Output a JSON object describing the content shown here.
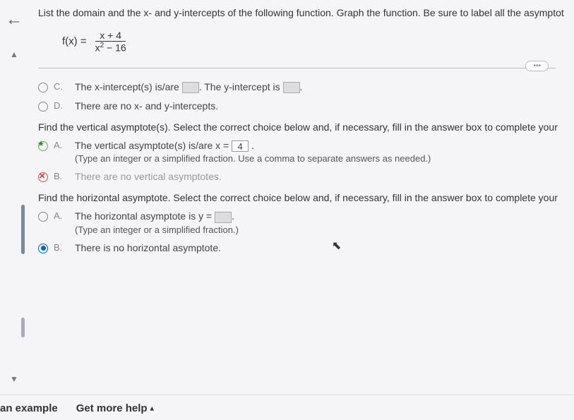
{
  "question": {
    "prompt": "List the domain and the x- and y-intercepts of the following function. Graph the function. Be sure to label all the asymptot",
    "formula_lhs": "f(x) =",
    "formula_num": "x + 4",
    "formula_den_base": "x",
    "formula_den_exp": "2",
    "formula_den_tail": " − 16"
  },
  "intercepts": {
    "optC_label": "C.",
    "optC_text1": "The x-intercept(s) is/are ",
    "optC_text2": ". The y-intercept is ",
    "optC_text3": ".",
    "optD_label": "D.",
    "optD_text": "There are no x- and y-intercepts."
  },
  "vertical": {
    "prompt": "Find the vertical asymptote(s). Select the correct choice below and, if necessary, fill in the answer box to complete your ",
    "optA_label": "A.",
    "optA_text": "The vertical asymptote(s) is/are x = ",
    "optA_value": "4",
    "optA_tail": " .",
    "optA_hint": "(Type an integer or a simplified fraction. Use a comma to separate answers as needed.)",
    "optB_label": "B.",
    "optB_text": "There are no vertical asymptotes."
  },
  "horizontal": {
    "prompt": "Find the horizontal asymptote. Select the correct choice below and, if necessary, fill in the answer box to complete your",
    "optA_label": "A.",
    "optA_text": "The horizontal asymptote is y = ",
    "optA_tail": ".",
    "optA_hint": "(Type an integer or a simplified fraction.)",
    "optB_label": "B.",
    "optB_text": "There is no horizontal asymptote."
  },
  "footer": {
    "example": "an example",
    "help": "Get more help"
  },
  "icons": {
    "back": "←",
    "pin": "▲",
    "down": "▼",
    "ellipsis": "•••",
    "cursor": "↖",
    "caret_up": "▴"
  }
}
